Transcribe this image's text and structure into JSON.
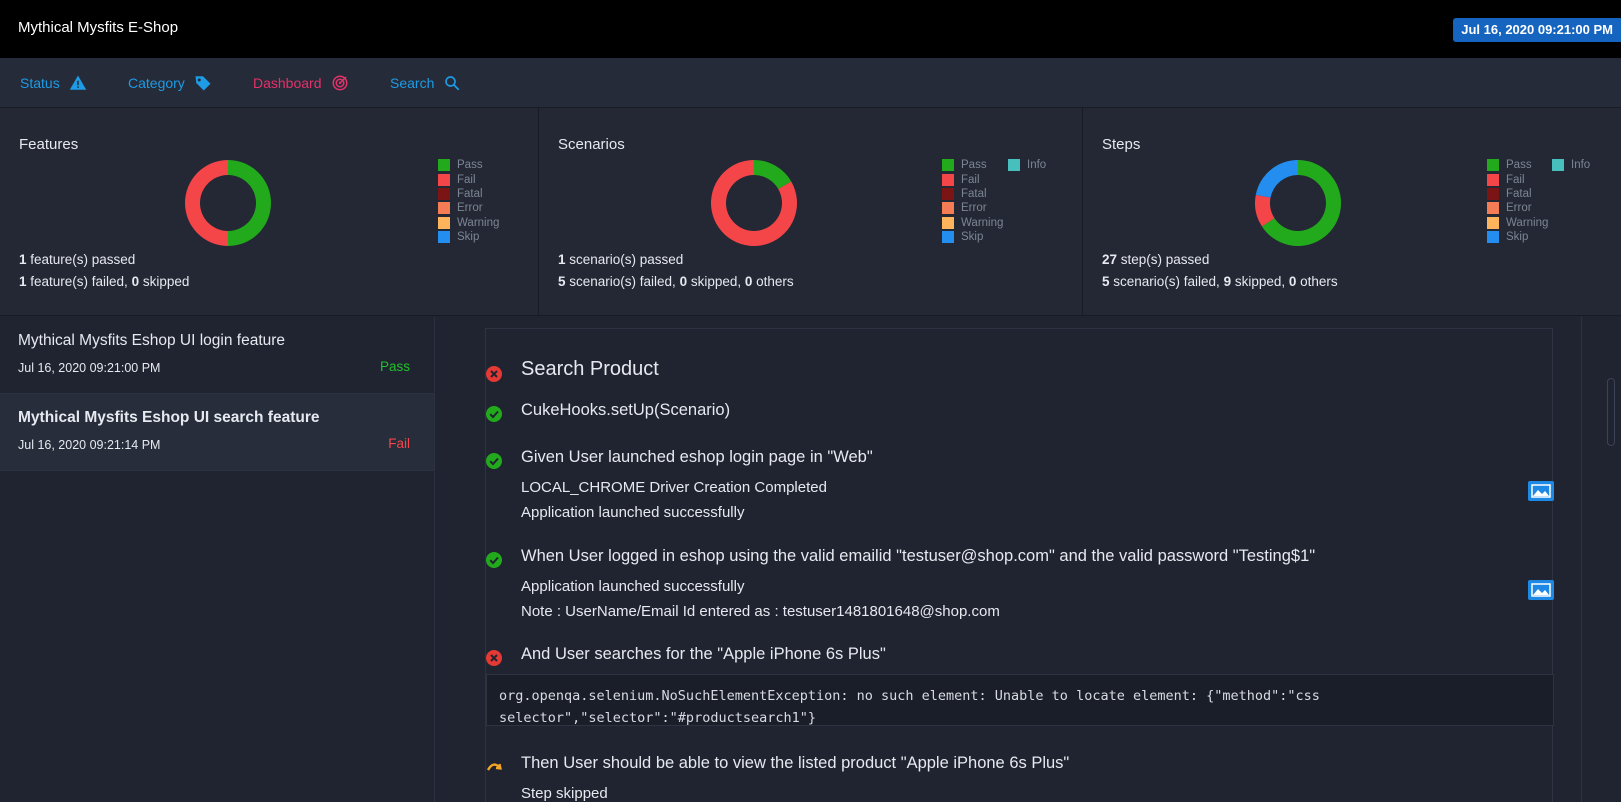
{
  "app": {
    "title": "Mythical Mysfits E-Shop",
    "date_badge": "Jul 16, 2020 09:21:00 PM"
  },
  "nav": [
    {
      "label": "Status",
      "icon": "warning-icon",
      "color": "#1e9be5"
    },
    {
      "label": "Category",
      "icon": "tag-icon",
      "color": "#1e9be5"
    },
    {
      "label": "Dashboard",
      "icon": "dashboard-icon",
      "color": "#e5316a"
    },
    {
      "label": "Search",
      "icon": "search-icon",
      "color": "#1e9be5"
    }
  ],
  "colors": {
    "pass": "#22aa1c",
    "fail": "#f44649",
    "fatal": "#7b1414",
    "error": "#f47d55",
    "warning": "#fdb45c",
    "skip": "#238df0",
    "info": "#46bfbd"
  },
  "legend_labels": {
    "pass": "Pass",
    "fail": "Fail",
    "fatal": "Fatal",
    "error": "Error",
    "warning": "Warning",
    "skip": "Skip",
    "info": "Info"
  },
  "cards": {
    "features": {
      "title": "Features",
      "line1": {
        "n": "1",
        "text": " feature(s) passed"
      },
      "line2": {
        "n1": "1",
        "t1": " feature(s) failed, ",
        "n2": "0",
        "t2": " skipped"
      }
    },
    "scenarios": {
      "title": "Scenarios",
      "line1": {
        "n": "1",
        "text": " scenario(s) passed"
      },
      "line2": {
        "n1": "5",
        "t1": " scenario(s) failed, ",
        "n2": "0",
        "t2": " skipped, ",
        "n3": "0",
        "t3": " others"
      }
    },
    "steps": {
      "title": "Steps",
      "line1": {
        "n": "27",
        "text": " step(s) passed"
      },
      "line2": {
        "n1": "5",
        "t1": " scenario(s) failed, ",
        "n2": "9",
        "t2": " skipped, ",
        "n3": "0",
        "t3": " others"
      }
    }
  },
  "chart_data": [
    {
      "type": "pie",
      "title": "Features",
      "categories": [
        "Pass",
        "Fail",
        "Fatal",
        "Error",
        "Warning",
        "Skip"
      ],
      "values": [
        1,
        1,
        0,
        0,
        0,
        0
      ]
    },
    {
      "type": "pie",
      "title": "Scenarios",
      "categories": [
        "Pass",
        "Fail",
        "Fatal",
        "Error",
        "Warning",
        "Skip",
        "Info"
      ],
      "values": [
        1,
        5,
        0,
        0,
        0,
        0,
        0
      ]
    },
    {
      "type": "pie",
      "title": "Steps",
      "categories": [
        "Pass",
        "Fail",
        "Fatal",
        "Error",
        "Warning",
        "Skip",
        "Info"
      ],
      "values": [
        27,
        5,
        0,
        0,
        0,
        9,
        0
      ]
    }
  ],
  "features": [
    {
      "title": "Mythical Mysfits Eshop UI login feature",
      "date": "Jul 16, 2020 09:21:00 PM",
      "status": "Pass"
    },
    {
      "title": "Mythical Mysfits Eshop UI search feature",
      "date": "Jul 16, 2020 09:21:14 PM",
      "status": "Fail"
    }
  ],
  "scenario": {
    "title": "Search Product",
    "steps": [
      {
        "text": "CukeHooks.setUp(Scenario)",
        "status": "pass"
      },
      {
        "text": "Given User launched eshop login page in \"Web\"",
        "status": "pass",
        "logs": [
          "LOCAL_CHROME Driver Creation Completed",
          "Application launched successfully"
        ]
      },
      {
        "text": "When User logged in eshop using the valid emailid \"testuser@shop.com\" and the valid password \"Testing$1\"",
        "status": "pass",
        "logs": [
          "Application launched successfully",
          "Note : UserName/Email Id entered as : testuser1481801648@shop.com"
        ]
      },
      {
        "text": "And User searches for the \"Apple iPhone 6s Plus\"",
        "status": "fail",
        "error": "org.openqa.selenium.NoSuchElementException: no such element: Unable to locate element: {\"method\":\"css selector\",\"selector\":\"#productsearch1\"}"
      },
      {
        "text": "Then User should be able to view the listed product \"Apple iPhone 6s Plus\"",
        "status": "skip",
        "logs": [
          "Step skipped"
        ]
      }
    ]
  }
}
